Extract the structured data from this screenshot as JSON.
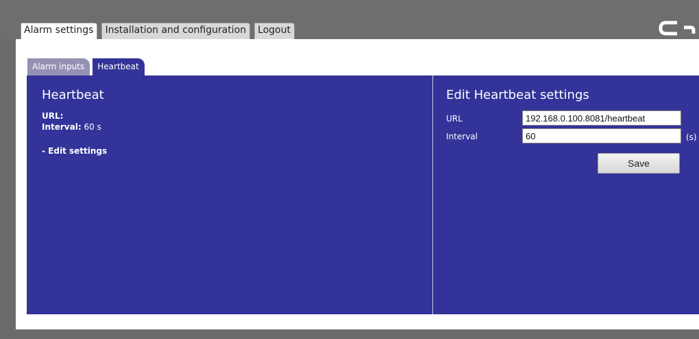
{
  "main_tabs": [
    {
      "label": "Alarm settings",
      "active": true
    },
    {
      "label": "Installation and configuration",
      "active": false
    },
    {
      "label": "Logout",
      "active": false
    }
  ],
  "sub_tabs": [
    {
      "label": "Alarm inputs",
      "active": false
    },
    {
      "label": "Heartbeat",
      "active": true
    }
  ],
  "left_panel": {
    "title": "Heartbeat",
    "url_label": "URL:",
    "url_value": "",
    "interval_label": "Interval:",
    "interval_value": "60 s",
    "edit_link": "- Edit settings"
  },
  "right_panel": {
    "title": "Edit Heartbeat settings",
    "url_label": "URL",
    "url_value": "192.168.0.100.8081/heartbeat",
    "interval_label": "Interval",
    "interval_value": "60",
    "interval_unit": "(s)",
    "save_label": "Save"
  },
  "colors": {
    "panel_bg": "#333399",
    "header_bg": "#6e6e6e"
  }
}
